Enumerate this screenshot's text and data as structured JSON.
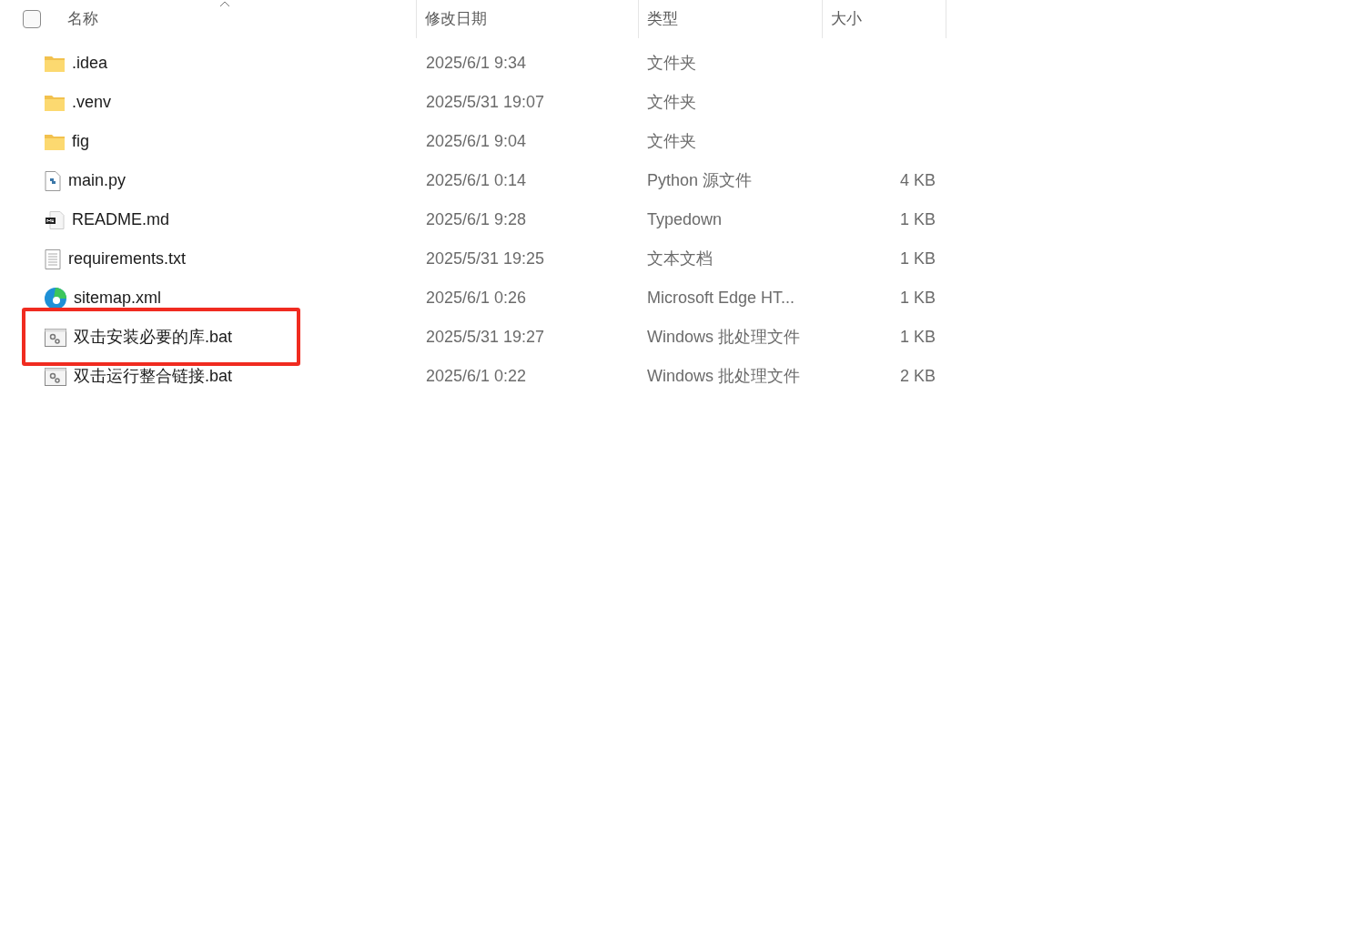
{
  "header": {
    "select_all_checked": false,
    "columns": [
      {
        "label": "名称",
        "sorted": true
      },
      {
        "label": "修改日期",
        "sorted": false
      },
      {
        "label": "类型",
        "sorted": false
      },
      {
        "label": "大小",
        "sorted": false
      }
    ]
  },
  "rows": [
    {
      "kind": "folder",
      "name": ".idea",
      "date": "2025/6/1 9:34",
      "type": "文件夹",
      "highlighted": false
    },
    {
      "kind": "folder",
      "name": ".venv",
      "date": "2025/5/31 19:07",
      "type": "文件夹",
      "highlighted": false
    },
    {
      "kind": "folder",
      "name": "fig",
      "date": "2025/6/1 9:04",
      "type": "文件夹",
      "highlighted": false
    },
    {
      "kind": "python",
      "name": "main.py",
      "date": "2025/6/1 0:14",
      "type": "Python 源文件",
      "size": "4 KB",
      "highlighted": false
    },
    {
      "kind": "markdown",
      "name": "README.md",
      "date": "2025/6/1 9:28",
      "type": "Typedown",
      "size": "1 KB",
      "highlighted": false
    },
    {
      "kind": "text",
      "name": "requirements.txt",
      "date": "2025/5/31 19:25",
      "type": "文本文档",
      "size": "1 KB",
      "highlighted": false
    },
    {
      "kind": "edge",
      "name": "sitemap.xml",
      "date": "2025/6/1 0:26",
      "type": "Microsoft Edge HT...",
      "size": "1 KB",
      "highlighted": false
    },
    {
      "kind": "batch",
      "name": "双击安装必要的库.bat",
      "date": "2025/5/31 19:27",
      "type": "Windows 批处理文件",
      "size": "1 KB",
      "highlighted": true
    },
    {
      "kind": "batch",
      "name": "双击运行整合链接.bat",
      "date": "2025/6/1 0:22",
      "type": "Windows 批处理文件",
      "size": "2 KB",
      "highlighted": false
    }
  ]
}
